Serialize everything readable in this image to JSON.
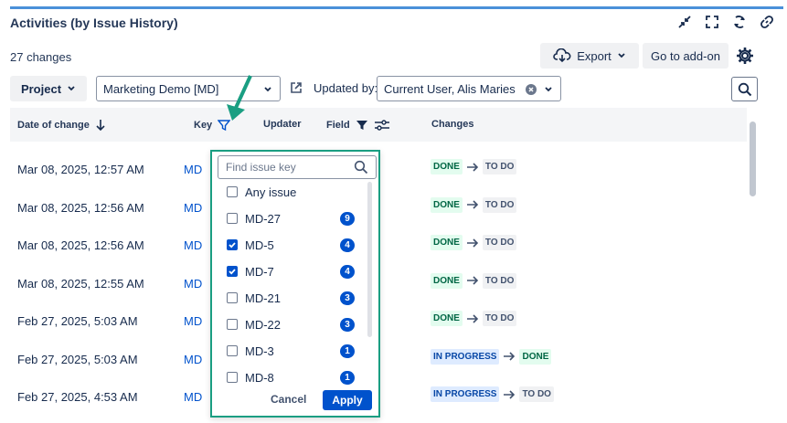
{
  "header": {
    "title": "Activities (by Issue History)"
  },
  "summary": {
    "changes": "27 changes"
  },
  "toolbar": {
    "export_label": "Export",
    "goto_label": "Go to add-on"
  },
  "filters": {
    "project_label": "Project",
    "project_value": "Marketing Demo [MD]",
    "updated_by_label": "Updated by:",
    "updated_by_value": "Current User, Alis Maries"
  },
  "table": {
    "columns": {
      "date": "Date of change",
      "key": "Key",
      "updater": "Updater",
      "field": "Field",
      "changes": "Changes"
    },
    "rows": [
      {
        "date": "Mar 08, 2025, 12:57 AM",
        "key": "MD",
        "from": "DONE",
        "to": "TO DO"
      },
      {
        "date": "Mar 08, 2025, 12:56 AM",
        "key": "MD",
        "from": "DONE",
        "to": "TO DO"
      },
      {
        "date": "Mar 08, 2025, 12:56 AM",
        "key": "MD",
        "from": "DONE",
        "to": "TO DO"
      },
      {
        "date": "Mar 08, 2025, 12:55 AM",
        "key": "MD",
        "from": "DONE",
        "to": "TO DO"
      },
      {
        "date": "Feb 27, 2025, 5:03 AM",
        "key": "MD",
        "from": "DONE",
        "to": "TO DO"
      },
      {
        "date": "Feb 27, 2025, 5:03 AM",
        "key": "MD",
        "from": "IN PROGRESS",
        "to": "DONE"
      },
      {
        "date": "Feb 27, 2025, 4:53 AM",
        "key": "MD",
        "from": "IN PROGRESS",
        "to": "TO DO"
      }
    ]
  },
  "key_filter": {
    "search_placeholder": "Find issue key",
    "options": [
      {
        "label": "Any issue",
        "checked": false,
        "count": ""
      },
      {
        "label": "MD-27",
        "checked": false,
        "count": "9"
      },
      {
        "label": "MD-5",
        "checked": true,
        "count": "4"
      },
      {
        "label": "MD-7",
        "checked": true,
        "count": "4"
      },
      {
        "label": "MD-21",
        "checked": false,
        "count": "3"
      },
      {
        "label": "MD-22",
        "checked": false,
        "count": "3"
      },
      {
        "label": "MD-3",
        "checked": false,
        "count": "1"
      },
      {
        "label": "MD-8",
        "checked": false,
        "count": "1"
      }
    ],
    "cancel_label": "Cancel",
    "apply_label": "Apply"
  },
  "colors": {
    "accent": "#0052cc",
    "highlight": "#1a9e82",
    "done_bg": "#e3fcef",
    "done_fg": "#006644",
    "progress_bg": "#deebff",
    "progress_fg": "#0747a6"
  }
}
